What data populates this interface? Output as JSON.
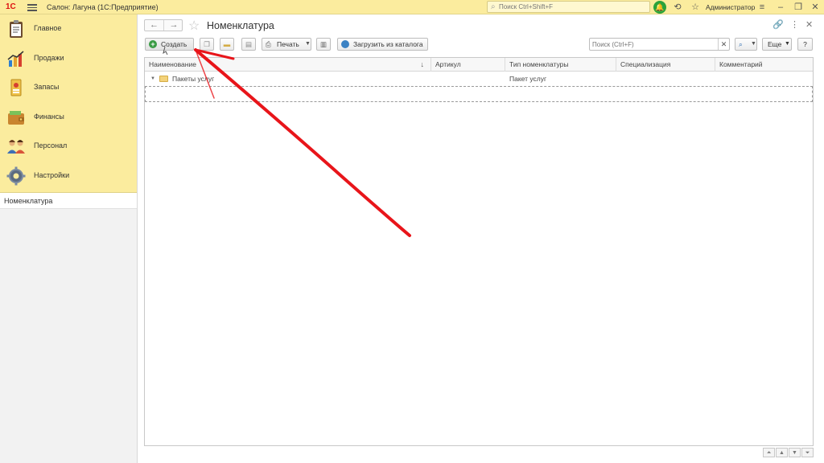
{
  "topbar": {
    "logo": "1С",
    "app_title": "Салон: Лагуна  (1С:Предприятие)",
    "search_placeholder": "Поиск Ctrl+Shift+F",
    "user": "Администратор"
  },
  "sidebar": {
    "items": [
      {
        "label": "Главное",
        "icon": "clipboard-icon"
      },
      {
        "label": "Продажи",
        "icon": "sales-chart-icon"
      },
      {
        "label": "Запасы",
        "icon": "inventory-icon"
      },
      {
        "label": "Финансы",
        "icon": "wallet-icon"
      },
      {
        "label": "Персонал",
        "icon": "people-icon"
      },
      {
        "label": "Настройки",
        "icon": "gear-icon"
      }
    ],
    "open_window": "Номенклатура"
  },
  "form": {
    "title": "Номенклатура",
    "buttons": {
      "create": "Создать",
      "print": "Печать",
      "load_catalog": "Загрузить из каталога",
      "more": "Еще",
      "help": "?"
    },
    "search_placeholder": "Поиск (Ctrl+F)"
  },
  "table": {
    "columns": [
      "Наименование",
      "Артикул",
      "Тип номенклатуры",
      "Специализация",
      "Комментарий"
    ],
    "rows": [
      {
        "name": "Пакеты услуг",
        "article": "",
        "type": "Пакет услуг",
        "specialization": "",
        "comment": ""
      }
    ]
  },
  "colors": {
    "sections_bg": "#fbec9e",
    "create_icon": "#3a9b44",
    "annotation_arrow": "#e8151a"
  }
}
